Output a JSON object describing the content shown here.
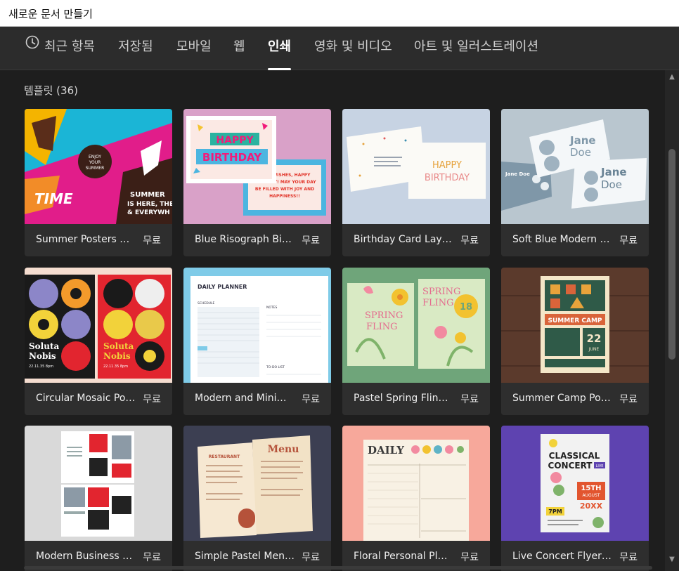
{
  "window": {
    "title": "새로운 문서 만들기"
  },
  "tabs": [
    {
      "label": "최근 항목",
      "icon": "clock-icon"
    },
    {
      "label": "저장됨"
    },
    {
      "label": "모바일"
    },
    {
      "label": "웹"
    },
    {
      "label": "인쇄",
      "active": true
    },
    {
      "label": "영화 및 비디오"
    },
    {
      "label": "아트 및 일러스트레이션"
    }
  ],
  "section": {
    "title": "템플릿 (36)"
  },
  "templates": [
    {
      "name": "Summer Posters Set",
      "price": "무료"
    },
    {
      "name": "Blue Risograph Birth...",
      "price": "무료"
    },
    {
      "name": "Birthday Card Layout...",
      "price": "무료"
    },
    {
      "name": "Soft Blue Modern Bu...",
      "price": "무료"
    },
    {
      "name": "Circular Mosaic Post...",
      "price": "무료"
    },
    {
      "name": "Modern and Minimal...",
      "price": "무료"
    },
    {
      "name": "Pastel Spring Fling Ev...",
      "price": "무료"
    },
    {
      "name": "Summer Camp Poster",
      "price": "무료"
    },
    {
      "name": "Modern Business Tri-...",
      "price": "무료"
    },
    {
      "name": "Simple Pastel Menu...",
      "price": "무료"
    },
    {
      "name": "Floral Personal Plann...",
      "price": "무료"
    },
    {
      "name": "Live Concert Flyer La...",
      "price": "무료"
    }
  ],
  "thumb_text": {
    "summer_time": "TIME",
    "summer_line1": "SUMMER",
    "summer_line2": "IS HERE, THE",
    "summer_line3": "& EVERYWH",
    "enjoy1": "ENJOY",
    "enjoy2": "YOUR",
    "enjoy3": "SUMMER",
    "happy": "HAPPY",
    "birthday": "BIRTHDAY",
    "riso_wish1": "BEST WISHES, HAPPY",
    "riso_wish2": "BIRTHDAY! MAY YOUR DAY",
    "riso_wish3": "BE FILLED WITH JOY AND",
    "riso_wish4": "HAPPINESS!!",
    "card_happy": "HAPPY",
    "card_birthday": "BIRTHDAY",
    "jane": "Jane",
    "doe": "Doe",
    "small_jane_doe": "Jane Doe",
    "soluta": "Soluta",
    "nobis": "Nobis",
    "mosaic_date": "22.11.35 8pm",
    "planner_title": "DAILY PLANNER",
    "planner_schedule": "SCHEDULE",
    "planner_notes": "NOTES",
    "planner_todo": "TO-DO LIST",
    "spring": "SPRING",
    "fling": "FLING",
    "spring_date": "18",
    "camp_title": "SUMMER CAMP",
    "camp_day": "22",
    "camp_month": "JUNE",
    "menu_title": "Menu",
    "menu_restaurant": "RESTAURANT",
    "daily": "DAILY",
    "concert1": "CLASSICAL",
    "concert2": "CONCERT",
    "concert_live": "LIVE",
    "concert_date": "15TH",
    "concert_month": "AUGUST",
    "concert_year": "20XX",
    "concert_time": "7PM"
  }
}
